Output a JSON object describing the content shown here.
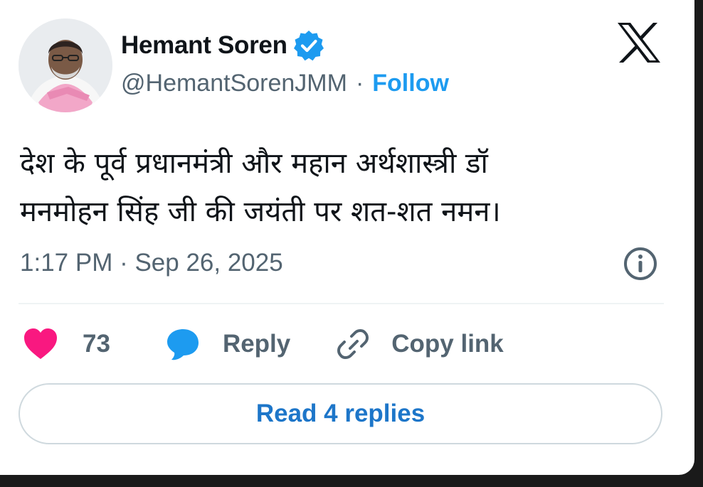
{
  "tweet": {
    "author": {
      "display_name": "Hemant Soren",
      "handle": "@HemantSorenJMM",
      "verified": true,
      "avatar_icon": "profile-photo"
    },
    "separator": "·",
    "follow_label": "Follow",
    "platform_icon": "x-logo-icon",
    "text_lines": [
      "देश के पूर्व प्रधानमंत्री और महान अर्थशास्त्री डॉ",
      "मनमोहन सिंह जी की जयंती पर शत-शत नमन।"
    ],
    "timestamp": "1:17 PM · Sep 26, 2025",
    "info_icon": "info-icon",
    "actions": {
      "like_count": "73",
      "reply_label": "Reply",
      "copy_link_label": "Copy link"
    },
    "read_replies_label": "Read 4 replies"
  },
  "colors": {
    "accent": "#1d9bf0",
    "like": "#f91880",
    "text_primary": "#0f1419",
    "text_secondary": "#536471",
    "border": "#cfd9de"
  }
}
